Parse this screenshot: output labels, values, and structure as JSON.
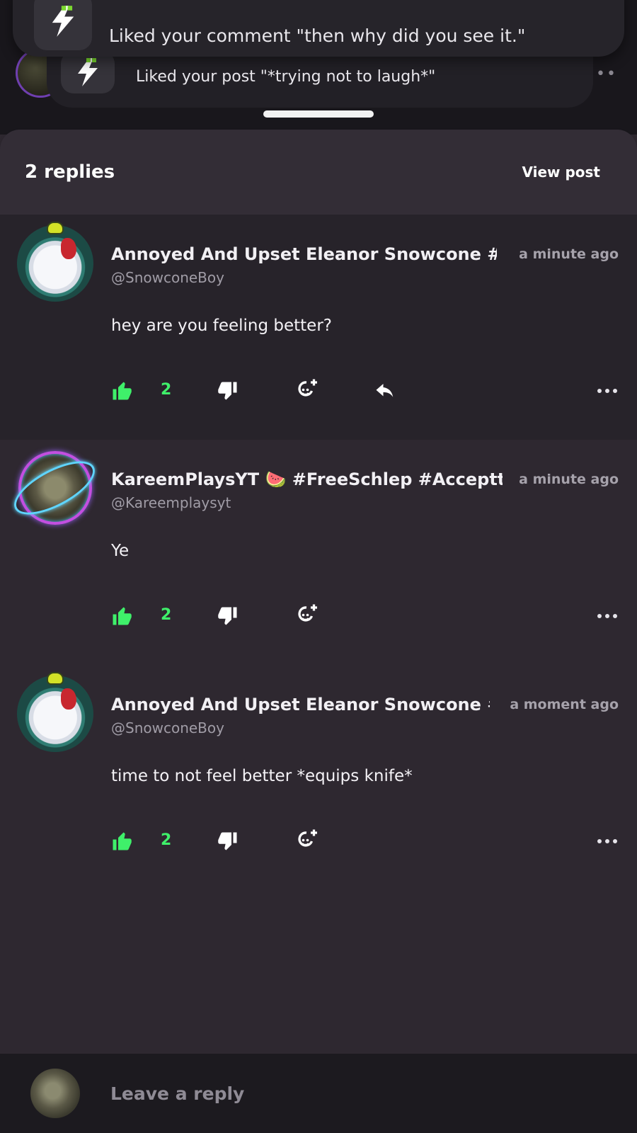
{
  "notifications": [
    {
      "text": "Liked your comment \"then why did you see it.\""
    },
    {
      "text": "Liked your post \"*trying not to laugh*\""
    }
  ],
  "header": {
    "title": "2 replies",
    "view_post_label": "View post"
  },
  "comments": [
    {
      "name": "Annoyed And Upset Eleanor Snowcone #Ju",
      "handle": "@SnowconeBoy",
      "time": "a minute ago",
      "text": "hey are you feeling better?",
      "likes": "2",
      "avatar": "anime-avatar-icon",
      "has_reply": true
    },
    {
      "name": "KareemPlaysYT 🍉 #FreeSchlep #Acceptthe",
      "handle": "@Kareemplaysyt",
      "time": "a minute ago",
      "text": "Ye",
      "likes": "2",
      "avatar": "photo-avatar-icon",
      "has_reply": false
    },
    {
      "name": "Annoyed And Upset Eleanor Snowcone #J",
      "handle": "@SnowconeBoy",
      "time": "a moment ago",
      "text": "time to not feel better *equips knife*",
      "likes": "2",
      "avatar": "anime-avatar-icon",
      "has_reply": false
    }
  ],
  "footer": {
    "reply_placeholder": "Leave a reply"
  },
  "colors": {
    "accent_green": "#3ff06a",
    "background": "#2e2830",
    "header": "#332d36"
  }
}
